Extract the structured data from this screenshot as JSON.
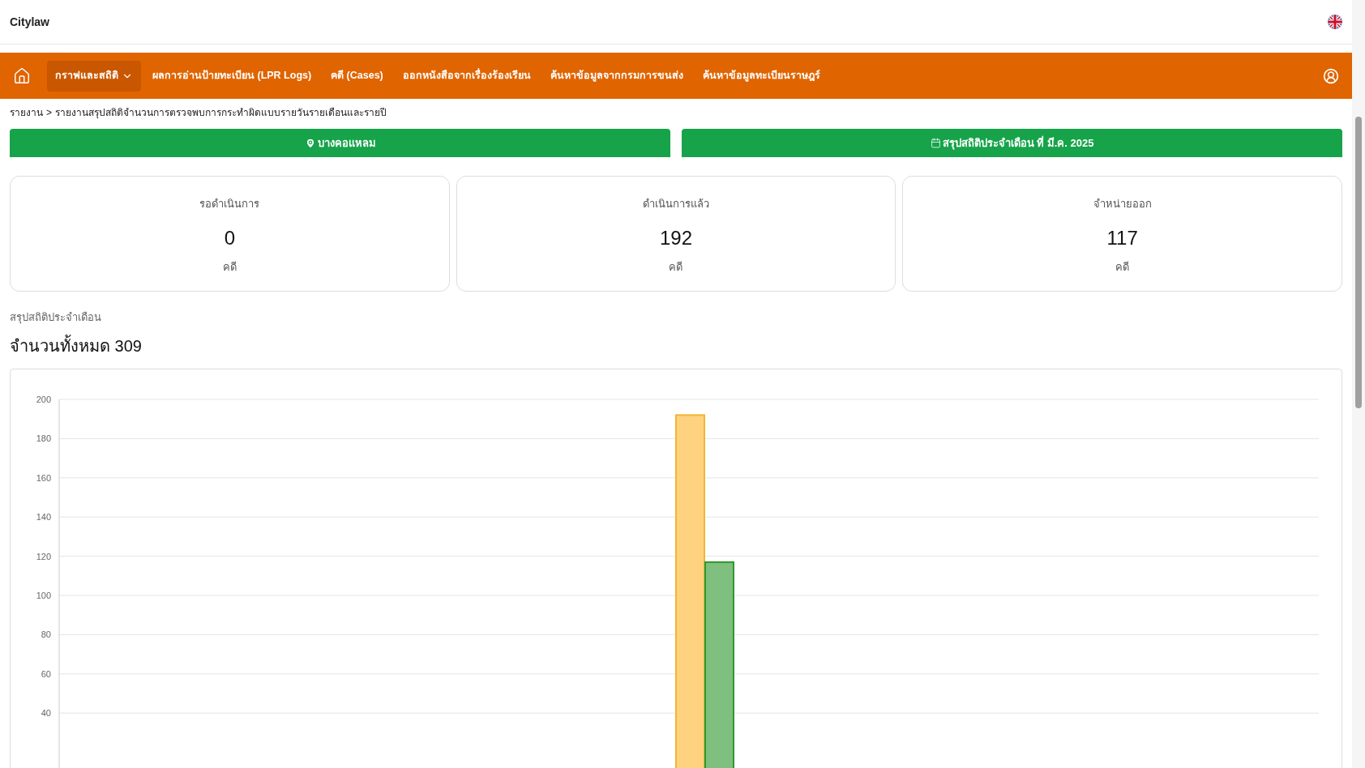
{
  "header": {
    "brand": "Citylaw"
  },
  "nav": {
    "items": [
      {
        "label": "กราฟและสถิติ",
        "kind": "dropdown",
        "selected": true
      },
      {
        "label": "ผลการอ่านป้ายทะเบียน (LPR Logs)",
        "kind": "link",
        "selected": false
      },
      {
        "label": "คดี (Cases)",
        "kind": "link",
        "selected": false
      },
      {
        "label": "ออกหนังสือจากเรื่องร้องเรียน",
        "kind": "link",
        "selected": false
      },
      {
        "label": "ค้นหาข้อมูลจากกรมการขนส่ง",
        "kind": "link",
        "selected": false
      },
      {
        "label": "ค้นหาข้อมูลทะเบียนราษฎร์",
        "kind": "link",
        "selected": false
      }
    ]
  },
  "breadcrumb": [
    "รายงาน",
    "รายงานสรุปสถิติจำนวนการตรวจพบการกระทำผิดแบบรายวันรายเดือนและรายปี"
  ],
  "breadcrumb_separator": ">",
  "filters": [
    {
      "kind": "location",
      "label": "บางคอแหลม"
    },
    {
      "kind": "date",
      "label": "สรุปสถิติประจำเดือน ที่ มี.ค. 2025"
    }
  ],
  "cards": [
    {
      "label": "รอดำเนินการ",
      "value": "0",
      "unit": "คดี"
    },
    {
      "label": "ดำเนินการแล้ว",
      "value": "192",
      "unit": "คดี"
    },
    {
      "label": "จำหน่ายออก",
      "value": "117",
      "unit": "คดี"
    }
  ],
  "summary": {
    "subtitle": "สรุปสถิติประจำเดือน",
    "total": "จำนวนทั้งหมด 309"
  },
  "chart_data": {
    "type": "bar",
    "grid": true,
    "ylim": [
      0,
      200
    ],
    "yticks": [
      40,
      60,
      80,
      100,
      120,
      140,
      160,
      180,
      200
    ],
    "series": [
      {
        "color": "#ffd27f",
        "values": [
          192
        ]
      },
      {
        "color": "#7fbf7f",
        "values": [
          117
        ]
      }
    ]
  }
}
